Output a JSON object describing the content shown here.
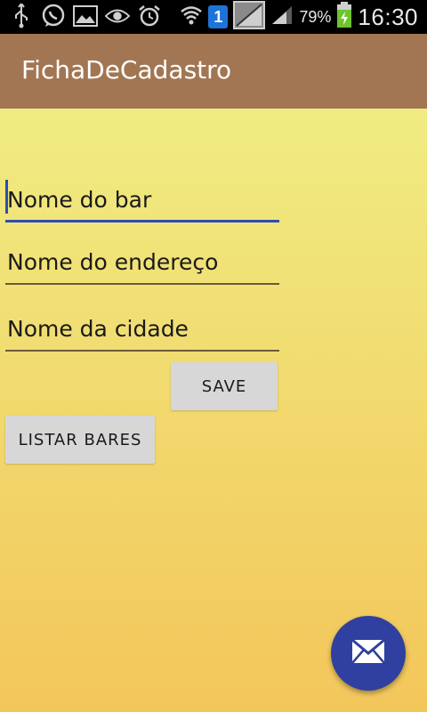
{
  "status_bar": {
    "battery_percent": "79%",
    "time": "16:30",
    "notification_badge": "1",
    "icons": [
      "usb-icon",
      "whatsapp-icon",
      "image-icon",
      "eye-icon",
      "alarm-icon",
      "wifi-icon",
      "sim-badge-icon",
      "no-signal-icon",
      "signal-icon",
      "battery-charging-icon"
    ]
  },
  "app_bar": {
    "title": "FichaDeCadastro",
    "color": "#a27652"
  },
  "form": {
    "bar_name_placeholder": "Nome do bar",
    "address_placeholder": "Nome do endereço",
    "city_placeholder": "Nome da cidade",
    "save_label": "SAVE",
    "list_bars_label": "LISTAR BARES",
    "accent_color": "#2e4db0"
  },
  "fab": {
    "icon": "mail-icon",
    "color": "#3040a0"
  }
}
